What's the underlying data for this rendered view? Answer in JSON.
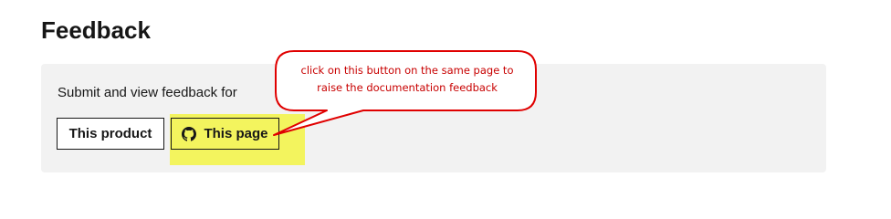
{
  "page": {
    "title": "Feedback"
  },
  "feedback": {
    "prompt": "Submit and view feedback for",
    "product_button": "This product",
    "page_button": "This page",
    "page_button_icon": "github-icon"
  },
  "annotation": {
    "line1": "click on this button on the same page  to",
    "line2": "raise the documentation feedback",
    "stroke_color": "#e00000",
    "text_color": "#c80000",
    "highlight_color": "#f3f45e"
  }
}
